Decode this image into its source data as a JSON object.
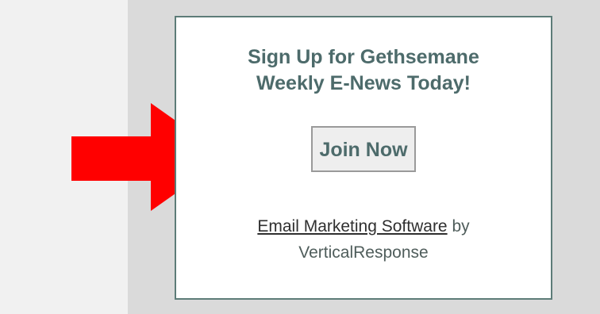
{
  "signup": {
    "headline_line1": "Sign Up for Gethsemane",
    "headline_line2": "Weekly E-News Today!",
    "join_label": "Join Now",
    "footer_link": "Email Marketing Software",
    "footer_by": " by",
    "footer_company": "VerticalResponse"
  },
  "colors": {
    "arrow": "#ff0000",
    "box_border": "#5d7c78",
    "heading_text": "#4d6b6b"
  },
  "icons": {
    "pointer": "arrow-right-icon"
  }
}
